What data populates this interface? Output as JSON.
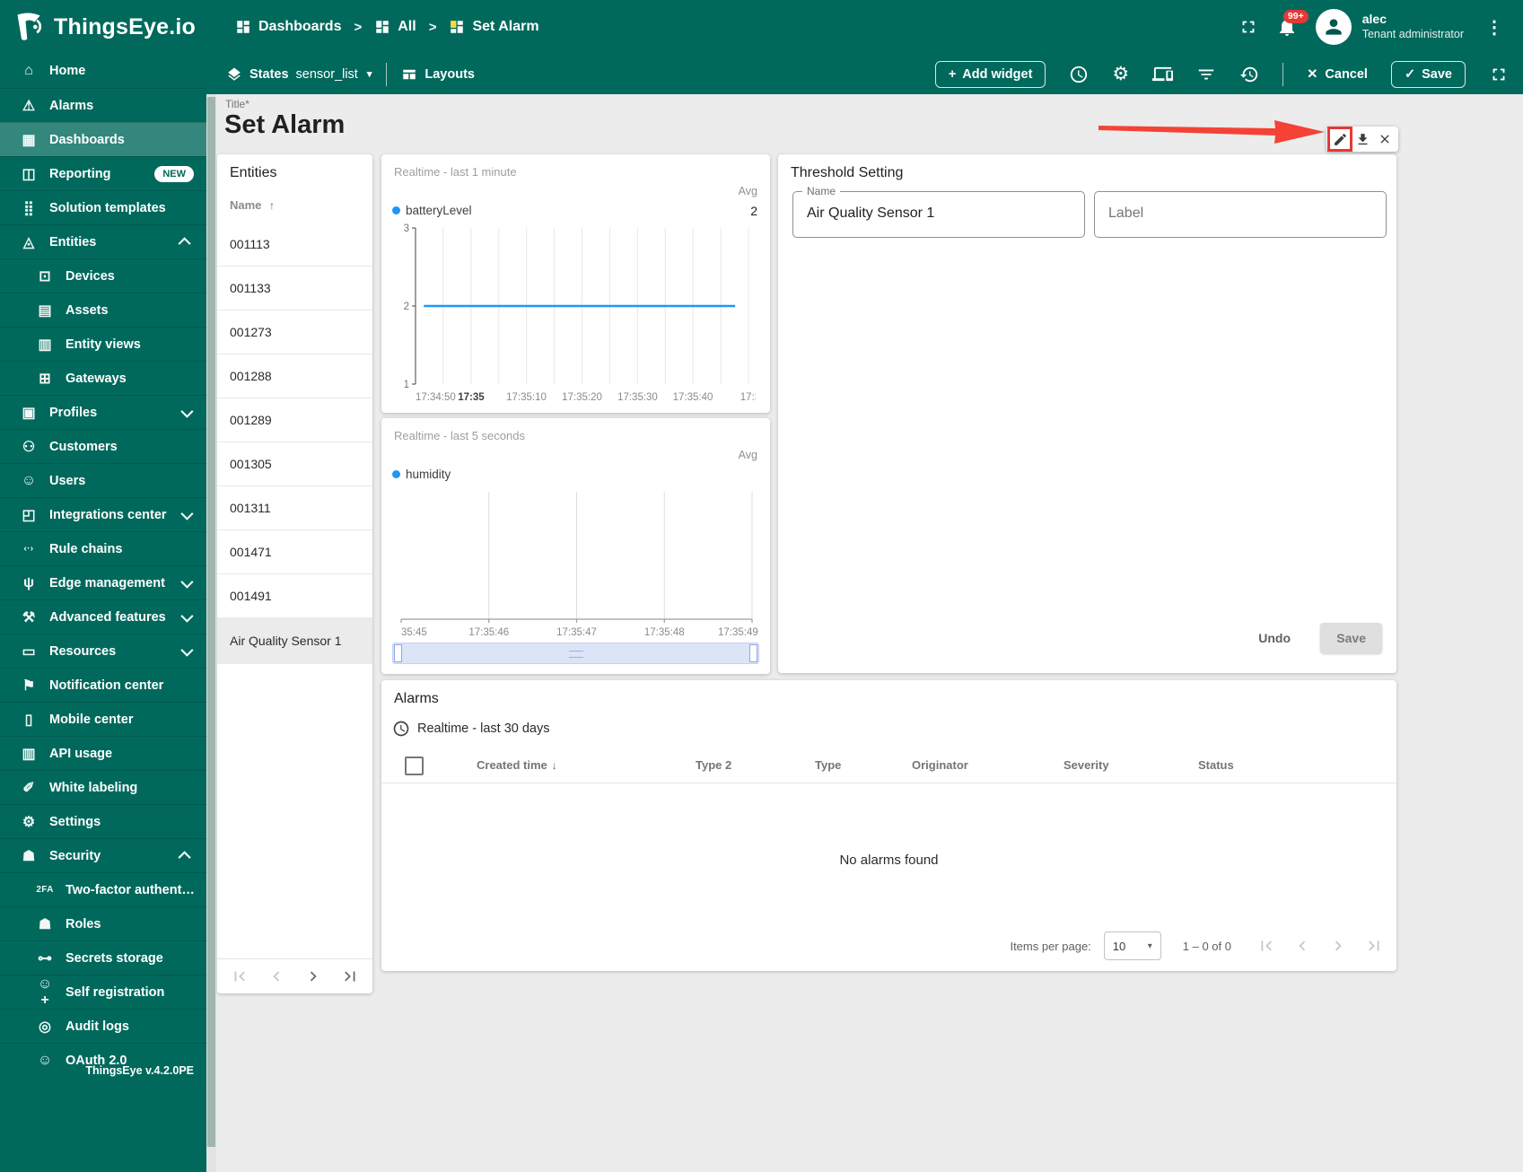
{
  "brand": {
    "logo_text": "ThingsEye.io",
    "version": "ThingsEye v.4.2.0PE"
  },
  "icons": {
    "kebab": "⋮",
    "caret_down": "▾",
    "crumb_separator": ">",
    "plus": "+",
    "close": "✕",
    "check": "✓",
    "gear": "⚙",
    "sort_asc": "↑",
    "sort_desc": "↓"
  },
  "header": {
    "breadcrumbs": [
      {
        "label": "Dashboards"
      },
      {
        "label": "All"
      },
      {
        "label": "Set Alarm"
      }
    ],
    "notifications_badge": "99+",
    "user": {
      "name": "alec",
      "role": "Tenant administrator"
    }
  },
  "toolbar": {
    "states_label": "States",
    "state_value": "sensor_list",
    "layouts_label": "Layouts",
    "add_widget_label": "Add widget",
    "cancel_label": "Cancel",
    "save_label": "Save"
  },
  "sidebar": {
    "items": [
      {
        "name": "home",
        "label": "Home",
        "glyph": "⌂"
      },
      {
        "name": "alarms",
        "label": "Alarms",
        "glyph": "⚠"
      },
      {
        "name": "dashboards",
        "label": "Dashboards",
        "glyph": "▦",
        "active": true
      },
      {
        "name": "reporting",
        "label": "Reporting",
        "glyph": "◫",
        "badge": "NEW"
      },
      {
        "name": "solution-templates",
        "label": "Solution templates",
        "glyph": "⣿"
      },
      {
        "name": "entities",
        "label": "Entities",
        "glyph": "◬",
        "expanded": true
      },
      {
        "name": "devices",
        "label": "Devices",
        "glyph": "⊡",
        "sub": true
      },
      {
        "name": "assets",
        "label": "Assets",
        "glyph": "▤",
        "sub": true
      },
      {
        "name": "entity-views",
        "label": "Entity views",
        "glyph": "▥",
        "sub": true
      },
      {
        "name": "gateways",
        "label": "Gateways",
        "glyph": "⊞",
        "sub": true
      },
      {
        "name": "profiles",
        "label": "Profiles",
        "glyph": "▣",
        "collapsible": true
      },
      {
        "name": "customers",
        "label": "Customers",
        "glyph": "⚇"
      },
      {
        "name": "users",
        "label": "Users",
        "glyph": "☺"
      },
      {
        "name": "integrations-center",
        "label": "Integrations center",
        "glyph": "◰",
        "collapsible": true
      },
      {
        "name": "rule-chains",
        "label": "Rule chains",
        "glyph": "‹·›"
      },
      {
        "name": "edge-management",
        "label": "Edge management",
        "glyph": "ψ",
        "collapsible": true
      },
      {
        "name": "advanced-features",
        "label": "Advanced features",
        "glyph": "⚒",
        "collapsible": true
      },
      {
        "name": "resources",
        "label": "Resources",
        "glyph": "▭",
        "collapsible": true
      },
      {
        "name": "notification-center",
        "label": "Notification center",
        "glyph": "⚑"
      },
      {
        "name": "mobile-center",
        "label": "Mobile center",
        "glyph": "▯"
      },
      {
        "name": "api-usage",
        "label": "API usage",
        "glyph": "▥"
      },
      {
        "name": "white-labeling",
        "label": "White labeling",
        "glyph": "✐"
      },
      {
        "name": "settings",
        "label": "Settings",
        "glyph": "⚙"
      },
      {
        "name": "security",
        "label": "Security",
        "glyph": "☗",
        "expanded": true
      },
      {
        "name": "two-factor",
        "label": "Two-factor authenticati…",
        "glyph": "2FA",
        "sub": true
      },
      {
        "name": "roles",
        "label": "Roles",
        "glyph": "☗",
        "sub": true
      },
      {
        "name": "secrets-storage",
        "label": "Secrets storage",
        "glyph": "⊶",
        "sub": true
      },
      {
        "name": "self-registration",
        "label": "Self registration",
        "glyph": "☺+",
        "sub": true
      },
      {
        "name": "audit-logs",
        "label": "Audit logs",
        "glyph": "◎",
        "sub": true
      },
      {
        "name": "oauth",
        "label": "OAuth 2.0",
        "glyph": "☺",
        "sub": true
      }
    ]
  },
  "page": {
    "title_label": "Title*",
    "title": "Set Alarm"
  },
  "entities_widget": {
    "title": "Entities",
    "name_header": "Name",
    "rows": [
      "001113",
      "001133",
      "001273",
      "001288",
      "001289",
      "001305",
      "001311",
      "001471",
      "001491",
      "Air Quality Sensor 1"
    ],
    "selected": "Air Quality Sensor 1"
  },
  "chart_data": [
    {
      "type": "line",
      "widget_header": "Realtime - last 1 minute",
      "legend": [
        {
          "label": "batteryLevel",
          "color": "#2196f3"
        }
      ],
      "agg_label": "Avg",
      "agg_value": "2",
      "y_ticks": [
        3,
        2,
        1
      ],
      "y_range": [
        1,
        3
      ],
      "grid_divisions": 12,
      "grid_color": "#e8e8e8",
      "x_ticks": [
        {
          "label": "17:34:50",
          "frac": 0,
          "anchor": "start"
        },
        {
          "label": "17:35",
          "frac": 0.167,
          "bold": true
        },
        {
          "label": "17:35:10",
          "frac": 0.333
        },
        {
          "label": "17:35:20",
          "frac": 0.5
        },
        {
          "label": "17:35:30",
          "frac": 0.667
        },
        {
          "label": "17:35:40",
          "frac": 0.833
        },
        {
          "label": "17:3",
          "frac": 0.975,
          "anchor": "start"
        }
      ],
      "series": [
        {
          "name": "batteryLevel",
          "color": "#2196f3",
          "constant_value": 2,
          "x_start_frac": 0.025,
          "x_end_frac": 0.96
        }
      ]
    },
    {
      "type": "line",
      "widget_header": "Realtime - last 5 seconds",
      "legend": [
        {
          "label": "humidity",
          "color": "#2196f3"
        }
      ],
      "agg_label": "Avg",
      "agg_value": "",
      "y_ticks": [],
      "grid_divisions": 4,
      "grid_color": "#dedede",
      "x_ticks": [
        {
          "label": "35:45",
          "frac": 0,
          "anchor": "start"
        },
        {
          "label": "17:35:46",
          "frac": 0.25
        },
        {
          "label": "17:35:47",
          "frac": 0.5
        },
        {
          "label": "17:35:48",
          "frac": 0.75
        },
        {
          "label": "17:35:49",
          "frac": 0.96
        }
      ],
      "series": [
        {
          "name": "humidity",
          "color": "#2196f3",
          "values": []
        }
      ]
    }
  ],
  "threshold_widget": {
    "title": "Threshold Setting",
    "name_label": "Name",
    "name_value": "Air Quality Sensor 1",
    "label_label": "Label",
    "undo_label": "Undo",
    "save_label": "Save"
  },
  "alarms_widget": {
    "title": "Alarms",
    "timewindow": "Realtime - last 30 days",
    "columns": [
      "Created time",
      "Type 2",
      "Type",
      "Originator",
      "Severity",
      "Status"
    ],
    "empty_text": "No alarms found",
    "items_per_page_label": "Items per page:",
    "items_per_page": "10",
    "range_label": "1 – 0 of 0"
  }
}
